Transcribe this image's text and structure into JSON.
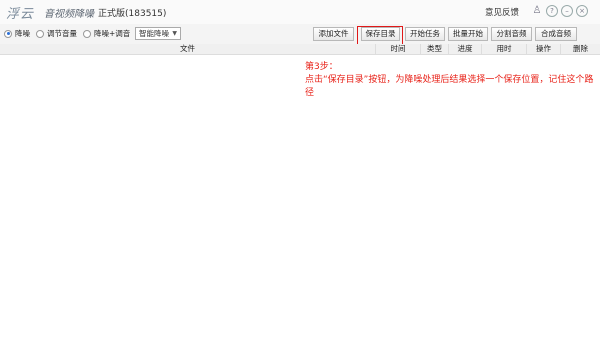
{
  "titlebar": {
    "logo_text": "浮云",
    "app_name": "音视频降噪",
    "version": "正式版(183515)",
    "feedback": "意见反馈",
    "icons": [
      "user-icon",
      "help-icon",
      "minimize-icon",
      "close-icon"
    ]
  },
  "toolbar": {
    "radios": [
      {
        "label": "降噪",
        "selected": true
      },
      {
        "label": "调节音量",
        "selected": false
      },
      {
        "label": "降噪+调音",
        "selected": false
      }
    ],
    "mode_select": "智能降噪",
    "buttons": [
      "添加文件",
      "保存目录",
      "开始任务",
      "批量开始",
      "分割音频",
      "合成音频"
    ]
  },
  "table": {
    "columns": [
      "文件",
      "时间",
      "类型",
      "进度",
      "用时",
      "操作",
      "删除"
    ]
  },
  "annotation": {
    "line1": "第3步：",
    "line2": "点击“保存目录”按钮，为降噪处理后结果选择一个保存位置，记住这个路径"
  },
  "colors": {
    "annotation": "#e8231a",
    "highlight_box": "#e01818",
    "radio_selected": "#2b6fd6"
  }
}
